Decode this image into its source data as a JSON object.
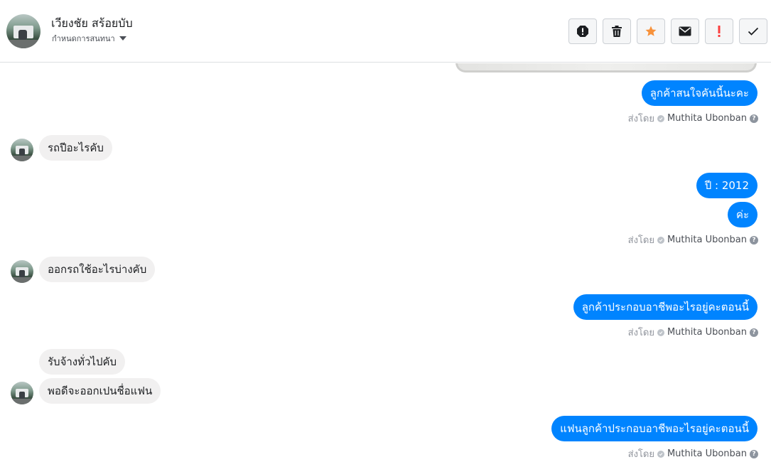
{
  "header": {
    "contact_name": "เวียงชัย สร้อยบับ",
    "status_label": "กำหนดการสนทนา"
  },
  "toolbar": {
    "buttons": [
      {
        "icon": "alert-octagon-icon"
      },
      {
        "icon": "trash-icon"
      },
      {
        "icon": "star-icon",
        "color": "#f7923b"
      },
      {
        "icon": "envelope-icon"
      },
      {
        "icon": "exclamation-icon",
        "color": "#fa3e3e"
      },
      {
        "icon": "checkmark-icon"
      }
    ]
  },
  "messages": [
    {
      "side": "out",
      "text": "ลูกค้าสนใจคันนี้นะคะ"
    },
    {
      "side": "in",
      "text": "รถปีอะไรคับ"
    },
    {
      "side": "out",
      "text": "ปี : 2012"
    },
    {
      "side": "out",
      "text": "ค่ะ"
    },
    {
      "side": "in",
      "text": "ออกรถใช้อะไรบ่างคับ"
    },
    {
      "side": "out",
      "text": "ลูกค้าประกอบอาชีพอะไรอยู่คะตอนนี้"
    },
    {
      "side": "in",
      "text": "รับจ้างทั่วไปคับ"
    },
    {
      "side": "in",
      "text": "พอดีจะออกเปนชื่อแฟน"
    },
    {
      "side": "out",
      "text": "แฟนลูกค้าประกอบอาชีพอะไรอยู่คะตอนนี้"
    }
  ],
  "sent_by": {
    "prefix": "ส่งโดย",
    "agent": "Muthita Ubonban",
    "help": "?"
  },
  "colors": {
    "outgoing_bubble": "#0084ff",
    "incoming_bubble": "#f1f0f0"
  }
}
